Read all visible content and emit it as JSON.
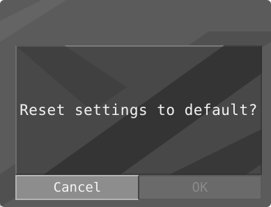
{
  "dialog": {
    "message": "Reset settings to default?",
    "buttons": {
      "cancel_label": "Cancel",
      "ok_label": "OK"
    },
    "selected_button": "Cancel",
    "ok_enabled": false
  },
  "colors": {
    "backdrop": "#5b5b5b",
    "dialog_bg": "#484848",
    "selected_button": "#8d8d8d",
    "disabled_button": "#6a6a6a",
    "text": "#f2f2f2"
  }
}
